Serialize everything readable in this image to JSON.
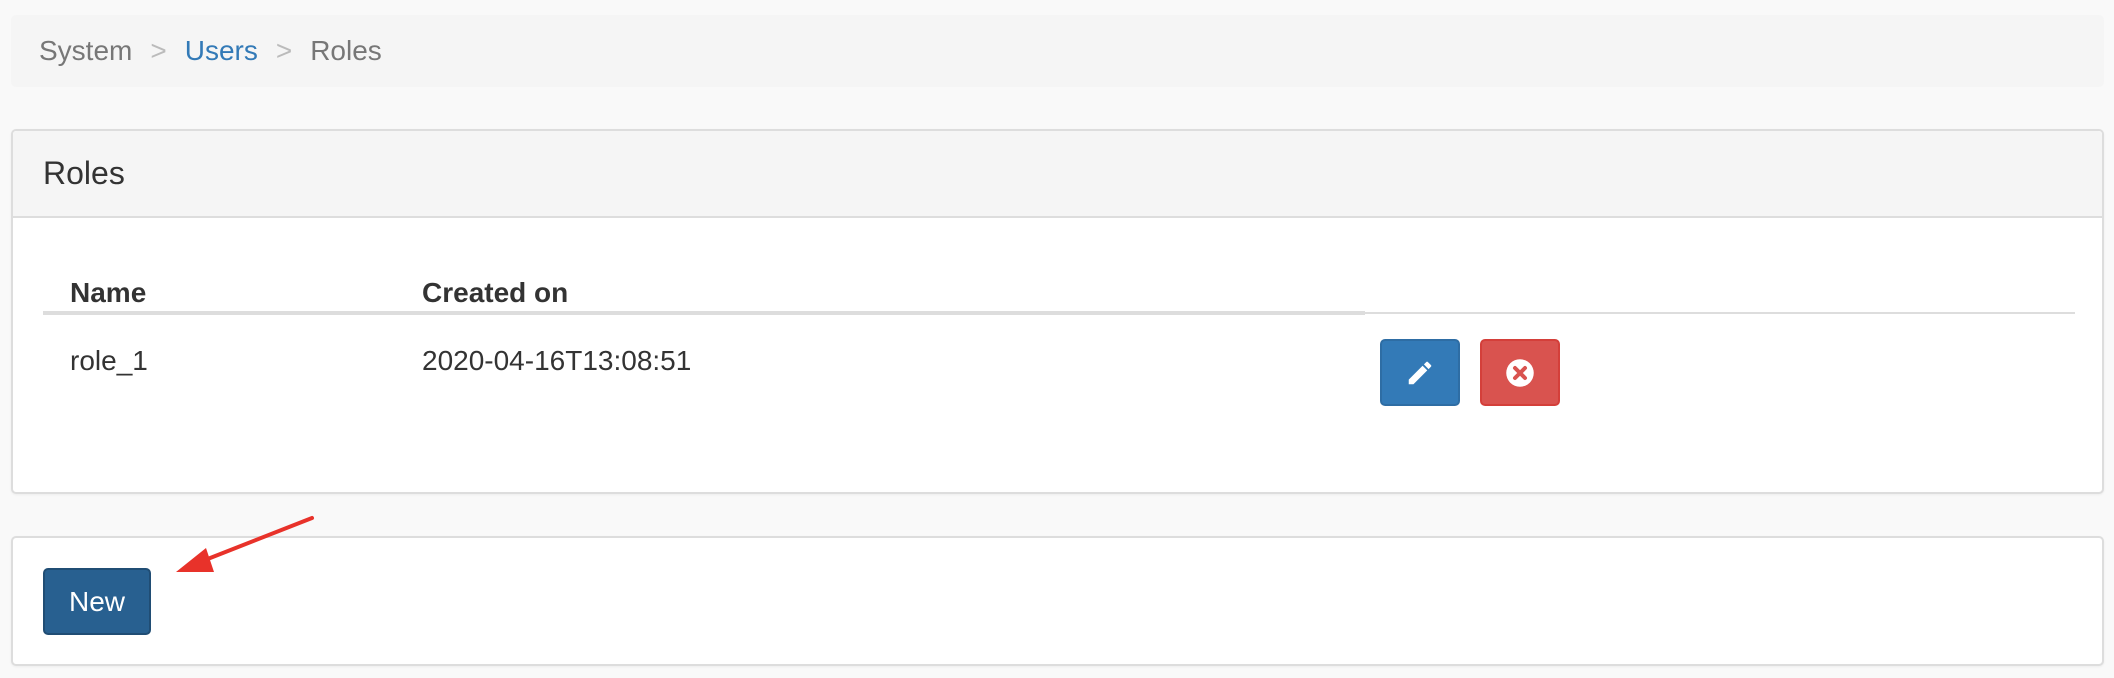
{
  "breadcrumb": {
    "items": [
      {
        "label": "System",
        "type": "text"
      },
      {
        "label": "Users",
        "type": "link"
      },
      {
        "label": "Roles",
        "type": "active"
      }
    ],
    "separator": ">"
  },
  "roles_panel": {
    "title": "Roles",
    "columns": [
      "Name",
      "Created on"
    ],
    "rows": [
      {
        "name": "role_1",
        "created_on": "2020-04-16T13:08:51"
      }
    ]
  },
  "actions_panel": {
    "new_label": "New"
  },
  "colors": {
    "primary": "#337ab7",
    "primary_dark": "#286090",
    "danger": "#d9534f",
    "annotation": "#e8322a"
  },
  "icons": {
    "edit": "pencil-icon",
    "delete": "remove-circle-icon"
  }
}
